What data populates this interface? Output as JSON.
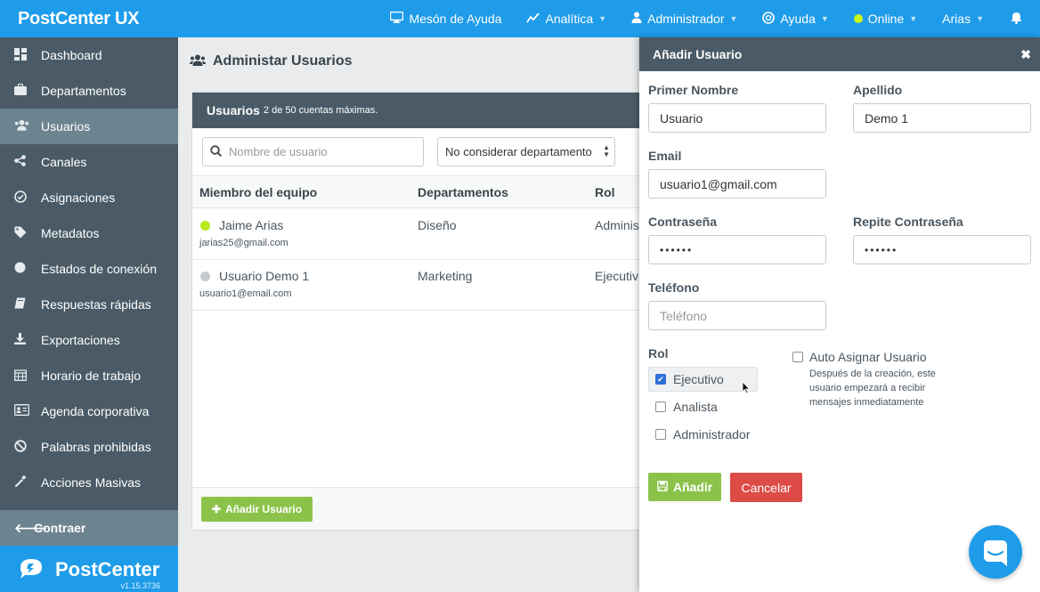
{
  "app": {
    "brand": "PostCenter UX",
    "accent": "#1e9ce9",
    "sidebar_color": "#4a5b67"
  },
  "topnav": {
    "help_desk": "Mesón de Ayuda",
    "analytics": "Analítica",
    "admin": "Administrador",
    "help": "Ayuda",
    "status": "Online",
    "user": "Arias"
  },
  "sidebar": {
    "items": [
      {
        "label": "Dashboard",
        "icon": "dashboard-icon"
      },
      {
        "label": "Departamentos",
        "icon": "briefcase-icon"
      },
      {
        "label": "Usuarios",
        "icon": "users-icon"
      },
      {
        "label": "Canales",
        "icon": "share-icon"
      },
      {
        "label": "Asignaciones",
        "icon": "check-circle-icon"
      },
      {
        "label": "Metadatos",
        "icon": "tag-icon"
      },
      {
        "label": "Estados de conexión",
        "icon": "circle-icon"
      },
      {
        "label": "Respuestas rápidas",
        "icon": "book-icon"
      },
      {
        "label": "Exportaciones",
        "icon": "download-icon"
      },
      {
        "label": "Horario de trabajo",
        "icon": "calendar-icon"
      },
      {
        "label": "Agenda corporativa",
        "icon": "id-card-icon"
      },
      {
        "label": "Palabras prohibidas",
        "icon": "ban-icon"
      },
      {
        "label": "Acciones Masivas",
        "icon": "wrench-icon"
      }
    ],
    "active_index": 2,
    "collapse": "Contraer",
    "brand": "PostCenter",
    "version": "v1.15.3736"
  },
  "main": {
    "title": "Administar Usuarios",
    "panel_title": "Usuarios",
    "panel_subtitle": "2 de 50 cuentas máximas.",
    "search_placeholder": "Nombre de usuario",
    "dept_filter": "No considerar departamento",
    "columns": {
      "member": "Miembro del equipo",
      "departments": "Departamentos",
      "role": "Rol"
    },
    "rows": [
      {
        "name": "Jaime Arias",
        "email": "jarias25@gmail.com",
        "department": "Diseño",
        "role": "Adminis",
        "status_color": "#b6ea1c"
      },
      {
        "name": "Usuario Demo 1",
        "email": "usuario1@email.com",
        "department": "Marketing",
        "role": "Ejecutiv",
        "status_color": "#c6c9cc"
      }
    ],
    "add_button": "Añadir Usuario"
  },
  "drawer": {
    "title": "Añadir Usuario",
    "first_name_label": "Primer Nombre",
    "first_name_value": "Usuario",
    "last_name_label": "Apellido",
    "last_name_value": "Demo 1",
    "email_label": "Email",
    "email_value": "usuario1@gmail.com",
    "password_label": "Contraseña",
    "password_value": "••••••",
    "password_repeat_label": "Repite Contraseña",
    "password_repeat_value": "••••••",
    "phone_label": "Teléfono",
    "phone_placeholder": "Teléfono",
    "role_label": "Rol",
    "roles": [
      {
        "label": "Ejecutivo",
        "checked": true
      },
      {
        "label": "Analista",
        "checked": false
      },
      {
        "label": "Administrador",
        "checked": false
      }
    ],
    "auto_assign_label": "Auto Asignar Usuario",
    "auto_assign_desc": "Después de la creación, este usuario empezará a recibir mensajes inmediatamente",
    "add_button": "Añadir",
    "cancel_button": "Cancelar",
    "add_color": "#8bc34a",
    "cancel_color": "#dd4b47"
  }
}
